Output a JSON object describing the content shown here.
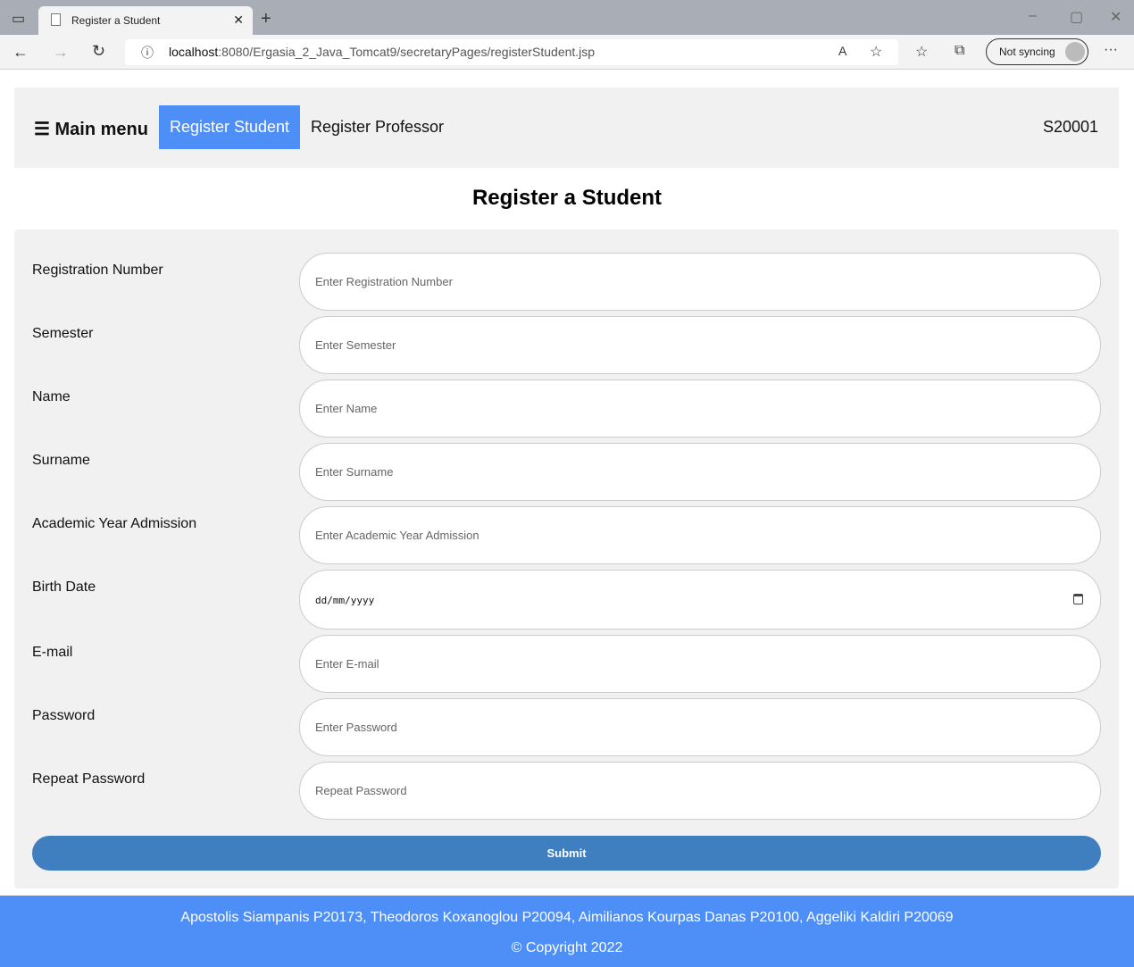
{
  "browser": {
    "tab_title": "Register a Student",
    "url_host": "localhost",
    "url_rest": ":8080/Ergasia_2_Java_Tomcat9/secretaryPages/registerStudent.jsp",
    "sync_label": "Not syncing"
  },
  "nav": {
    "menu_label": "☰ Main menu",
    "register_student": "Register Student",
    "register_professor": "Register Professor",
    "user_id": "S20001",
    "active_color": "#4e8ff7"
  },
  "page": {
    "title": "Register a Student"
  },
  "form": {
    "fields": [
      {
        "label": "Registration Number",
        "placeholder": "Enter Registration Number"
      },
      {
        "label": "Semester",
        "placeholder": "Enter Semester"
      },
      {
        "label": "Name",
        "placeholder": "Enter Name"
      },
      {
        "label": "Surname",
        "placeholder": "Enter Surname"
      },
      {
        "label": "Academic Year Admission",
        "placeholder": "Enter Academic Year Admission"
      },
      {
        "label": "Birth Date",
        "placeholder": "dd/mm/yyyy"
      },
      {
        "label": "E-mail",
        "placeholder": "Enter E-mail"
      },
      {
        "label": "Password",
        "placeholder": "Enter Password"
      },
      {
        "label": "Repeat Password",
        "placeholder": "Repeat Password"
      }
    ],
    "submit_label": "Submit"
  },
  "footer": {
    "authors": "Apostolis Siampanis P20173, Theodoros Koxanoglou P20094, Aimilianos Kourpas Danas P20100, Aggeliki Kaldiri P20069",
    "copyright": "© Copyright 2022"
  }
}
